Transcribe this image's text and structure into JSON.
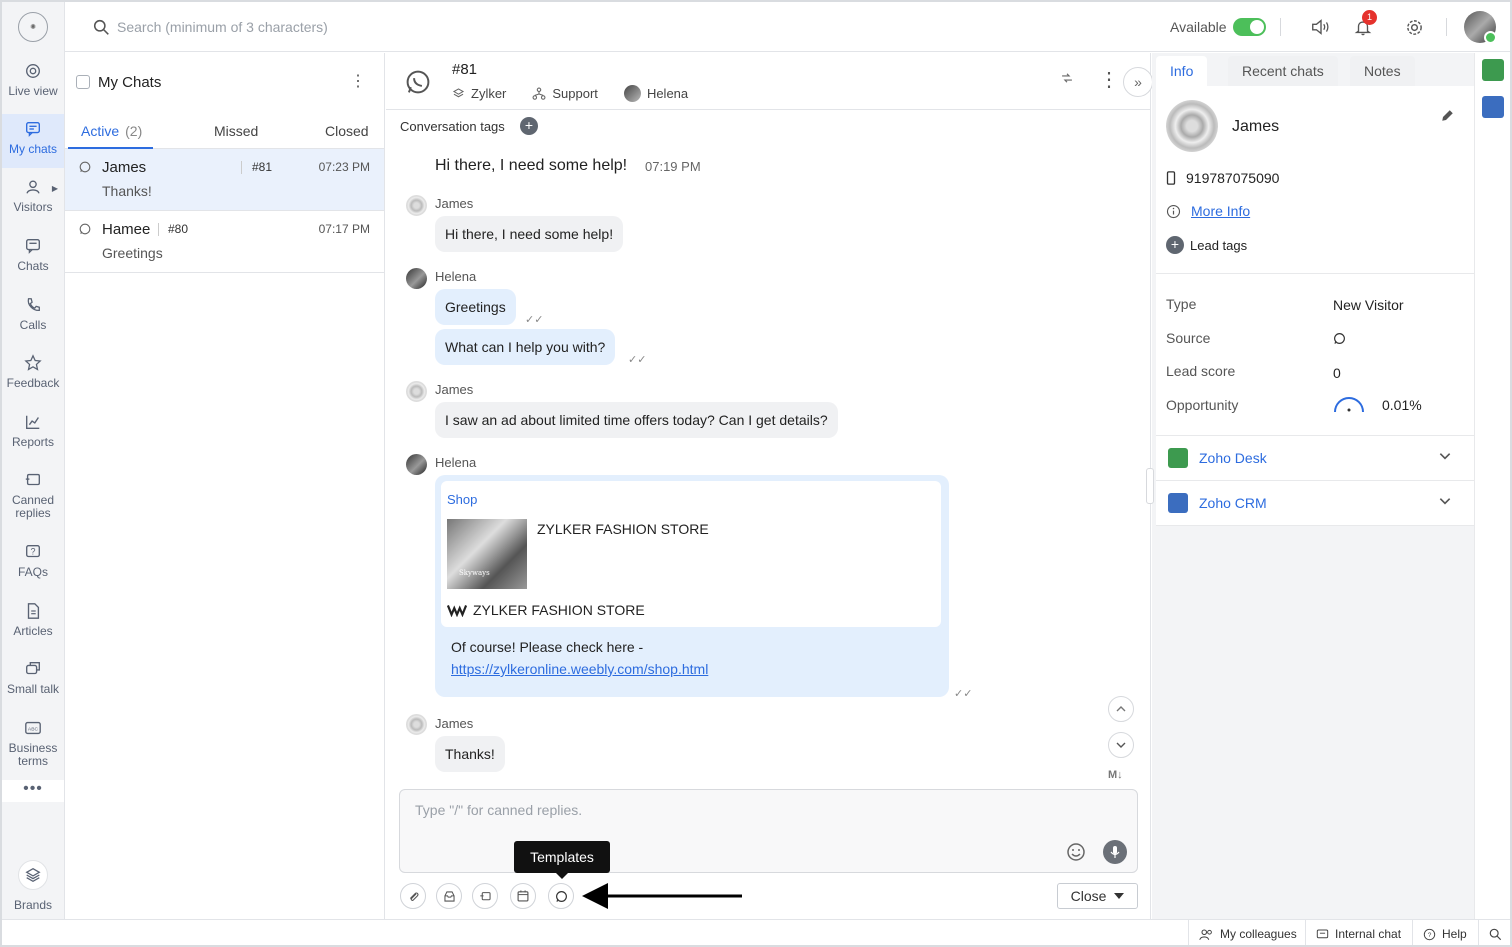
{
  "nav": {
    "items": [
      {
        "label": "Live view",
        "icon": "live-view-icon"
      },
      {
        "label": "My chats",
        "icon": "chat-bubble-icon"
      },
      {
        "label": "Visitors",
        "icon": "person-icon"
      },
      {
        "label": "Chats",
        "icon": "chats-icon"
      },
      {
        "label": "Calls",
        "icon": "phone-icon"
      },
      {
        "label": "Feedback",
        "icon": "star-icon"
      },
      {
        "label": "Reports",
        "icon": "chart-icon"
      },
      {
        "label": "Canned replies",
        "icon": "canned-icon"
      },
      {
        "label": "FAQs",
        "icon": "faq-icon"
      },
      {
        "label": "Articles",
        "icon": "article-icon"
      },
      {
        "label": "Small talk",
        "icon": "small-talk-icon"
      },
      {
        "label": "Business terms",
        "icon": "abc-icon"
      }
    ],
    "more": "•••",
    "brands": "Brands"
  },
  "topbar": {
    "search_placeholder": "Search (minimum of 3 characters)",
    "availability": "Available",
    "notification_count": "1"
  },
  "chatlist": {
    "title": "My Chats",
    "tabs": [
      {
        "label": "Active",
        "count": "(2)"
      },
      {
        "label": "Missed"
      },
      {
        "label": "Closed"
      }
    ],
    "rows": [
      {
        "name": "James",
        "id": "#81",
        "time": "07:23 PM",
        "message": "Thanks!"
      },
      {
        "name": "Hamee",
        "id": "#80",
        "time": "07:17 PM",
        "message": "Greetings"
      }
    ]
  },
  "chat": {
    "id": "#81",
    "brand": "Zylker",
    "department": "Support",
    "agent": "Helena",
    "tags_label": "Conversation tags",
    "first_message": "Hi there, I need some help!",
    "first_time": "07:19 PM",
    "messages": [
      {
        "sender": "James",
        "text": "Hi there, I need some help!"
      },
      {
        "sender": "Helena",
        "text": "Greetings"
      },
      {
        "sender": "Helena",
        "text": "What can I help you with?"
      },
      {
        "sender": "James",
        "text": "I saw an ad about limited time offers today? Can I get details?"
      },
      {
        "sender": "Helena"
      },
      {
        "sender": "James",
        "text": "Thanks!"
      }
    ],
    "card": {
      "header": "Shop",
      "title": "ZYLKER FASHION STORE",
      "site": "ZYLKER FASHION STORE",
      "image_caption": "Skyways",
      "text": "Of course! Please check here -",
      "link": "https://zylkeronline.weebly.com/shop.html"
    },
    "compose_placeholder": "Type \"/\" for canned replies.",
    "tooltip": "Templates",
    "close_label": "Close",
    "markdown": "M↓"
  },
  "visitor": {
    "tabs": [
      "Info",
      "Recent chats",
      "Notes"
    ],
    "name": "James",
    "phone": "919787075090",
    "more_info": "More Info",
    "lead_tags": "Lead tags",
    "props": [
      {
        "label": "Type",
        "value": "New Visitor"
      },
      {
        "label": "Source",
        "value": ""
      },
      {
        "label": "Lead score",
        "value": "0"
      },
      {
        "label": "Opportunity",
        "value": "0.01%"
      }
    ],
    "integrations": [
      "Zoho Desk",
      "Zoho CRM"
    ]
  },
  "footer": {
    "colleagues": "My colleagues",
    "internal_chat": "Internal chat",
    "help": "Help"
  },
  "colors": {
    "accent": "#2d6cdf",
    "available": "#4cbf5a",
    "zoho_desk": "#3d9a4f",
    "zoho_crm": "#3b6dbf"
  }
}
